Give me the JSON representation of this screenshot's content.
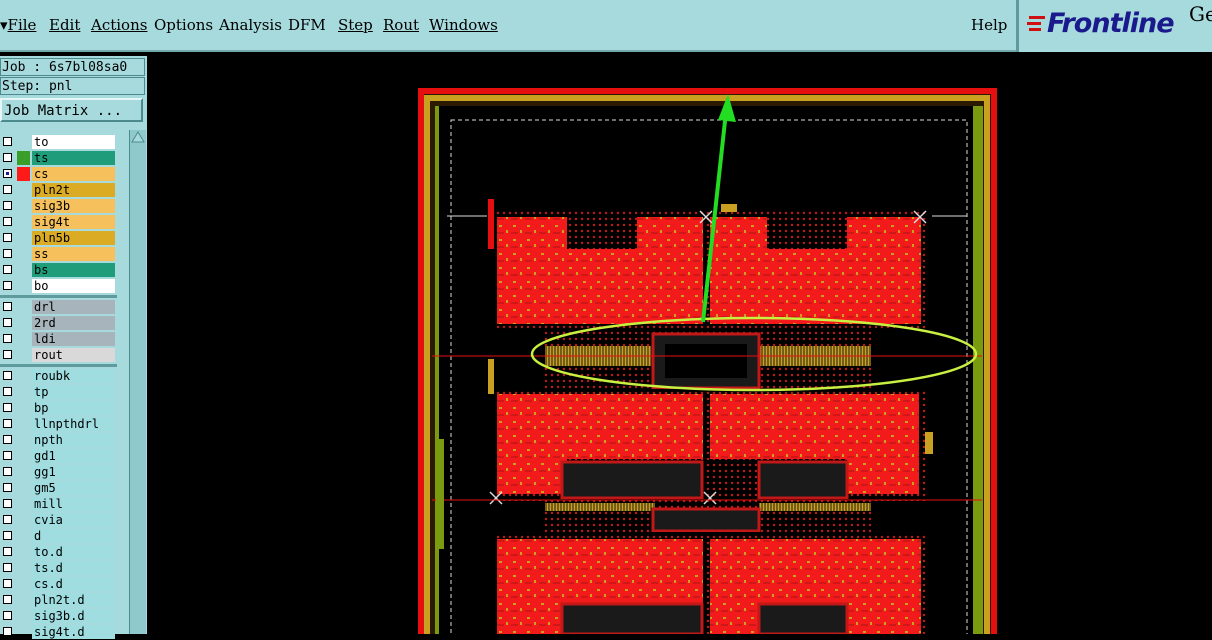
{
  "menubar": {
    "items": [
      {
        "label": "File",
        "prefix": "▾"
      },
      {
        "label": "Edit"
      },
      {
        "label": "Actions"
      },
      {
        "label": "Options"
      },
      {
        "label": "Analysis"
      },
      {
        "label": "DFM"
      },
      {
        "label": "Step"
      },
      {
        "label": "Rout"
      },
      {
        "label": "Windows"
      }
    ],
    "help": "Help"
  },
  "logo": {
    "name": "Frontline",
    "suffix": "Ge"
  },
  "job": {
    "job_line": "Job : 6s7bl08sa0",
    "step_line": "Step: pnl",
    "matrix_button": "Job Matrix ..."
  },
  "layers": [
    {
      "name": "to",
      "bg": "#ffffff",
      "swatch": ""
    },
    {
      "name": "ts",
      "bg": "#1f9c7a",
      "swatch": "#3a9e2a"
    },
    {
      "name": "cs",
      "bg": "#f6c15c",
      "swatch": "#ff1a1a",
      "active": true
    },
    {
      "name": "pln2t",
      "bg": "#dcab24",
      "swatch": ""
    },
    {
      "name": "sig3b",
      "bg": "#f6c15c",
      "swatch": ""
    },
    {
      "name": "sig4t",
      "bg": "#f6c15c",
      "swatch": ""
    },
    {
      "name": "pln5b",
      "bg": "#dcab24",
      "swatch": ""
    },
    {
      "name": "ss",
      "bg": "#f6c15c",
      "swatch": ""
    },
    {
      "name": "bs",
      "bg": "#1f9c7a",
      "swatch": ""
    },
    {
      "name": "bo",
      "bg": "#ffffff",
      "swatch": ""
    },
    {
      "name": "drl",
      "bg": "#a7b4bb",
      "swatch": ""
    },
    {
      "name": "2rd",
      "bg": "#a7b4bb",
      "swatch": ""
    },
    {
      "name": "ldi",
      "bg": "#a7b4bb",
      "swatch": ""
    },
    {
      "name": "rout",
      "bg": "#d9d9d9",
      "swatch": ""
    },
    {
      "name": "roubk",
      "bg": "#9fdde0",
      "swatch": ""
    },
    {
      "name": "tp",
      "bg": "#9fdde0",
      "swatch": ""
    },
    {
      "name": "bp",
      "bg": "#9fdde0",
      "swatch": ""
    },
    {
      "name": "llnpthdrl",
      "bg": "#9fdde0",
      "swatch": ""
    },
    {
      "name": "npth",
      "bg": "#9fdde0",
      "swatch": ""
    },
    {
      "name": "gd1",
      "bg": "#9fdde0",
      "swatch": ""
    },
    {
      "name": "gg1",
      "bg": "#9fdde0",
      "swatch": ""
    },
    {
      "name": "gm5",
      "bg": "#9fdde0",
      "swatch": ""
    },
    {
      "name": "mill",
      "bg": "#9fdde0",
      "swatch": ""
    },
    {
      "name": "cvia",
      "bg": "#9fdde0",
      "swatch": ""
    },
    {
      "name": "d",
      "bg": "#9fdde0",
      "swatch": ""
    },
    {
      "name": "to.d",
      "bg": "#9fdde0",
      "swatch": ""
    },
    {
      "name": "ts.d",
      "bg": "#9fdde0",
      "swatch": ""
    },
    {
      "name": "cs.d",
      "bg": "#9fdde0",
      "swatch": ""
    },
    {
      "name": "pln2t.d",
      "bg": "#9fdde0",
      "swatch": ""
    },
    {
      "name": "sig3b.d",
      "bg": "#9fdde0",
      "swatch": ""
    },
    {
      "name": "sig4t.d",
      "bg": "#9fdde0",
      "swatch": ""
    }
  ],
  "colors": {
    "panel_bg": "#a6dadd",
    "board_red": "#f21a1a",
    "copper_gold": "#c9a020",
    "frame_olive": "#7a9a10",
    "highlight_green": "#22dd22",
    "ellipse_yellowgreen": "#c8f040"
  }
}
